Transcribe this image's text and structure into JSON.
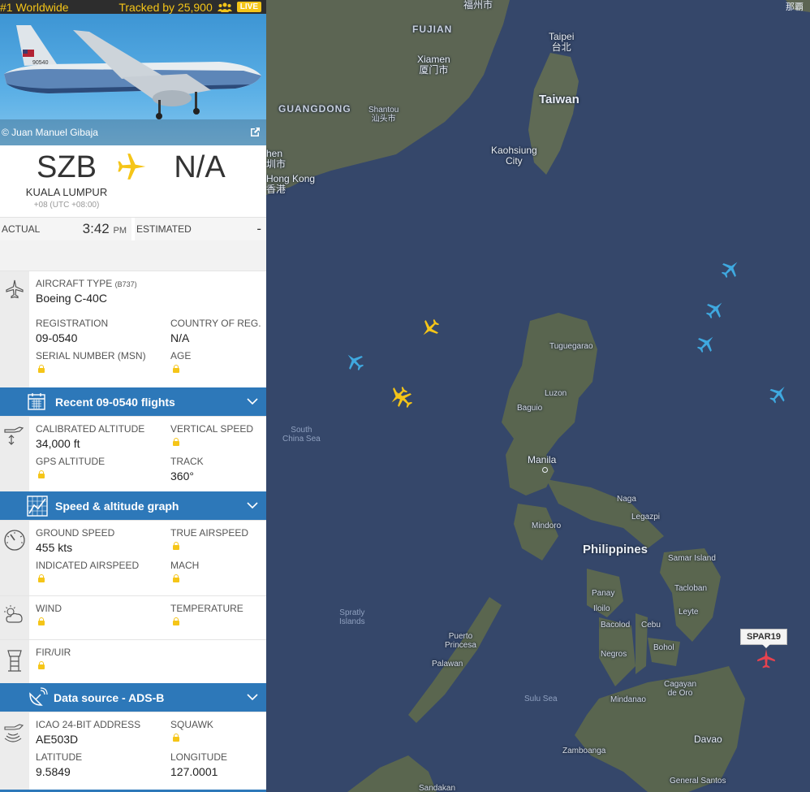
{
  "topbar": {
    "rank": "#1 Worldwide",
    "tracked": "Tracked by 25,900",
    "live": "LIVE"
  },
  "photo": {
    "credit": "© Juan Manuel Gibaja",
    "tail_text": "90540"
  },
  "route": {
    "origin_code": "SZB",
    "origin_city": "KUALA LUMPUR",
    "origin_tz": "+08 (UTC +08:00)",
    "dest_code": "N/A"
  },
  "times": {
    "actual_label": "ACTUAL",
    "actual_time": "3:42",
    "actual_ampm": "PM",
    "estimated_label": "ESTIMATED",
    "estimated_value": "-"
  },
  "aircraft": {
    "type_label": "AIRCRAFT TYPE",
    "type_code": "(B737)",
    "type_value": "Boeing C-40C",
    "registration_label": "REGISTRATION",
    "registration_value": "09-0540",
    "country_label": "COUNTRY OF REG.",
    "country_value": "N/A",
    "serial_label": "SERIAL NUMBER (MSN)",
    "age_label": "AGE"
  },
  "bars": {
    "recent_flights": "Recent 09-0540 flights",
    "speed_graph": "Speed & altitude graph",
    "data_source": "Data source - ADS-B"
  },
  "altitude": {
    "calibrated_label": "CALIBRATED ALTITUDE",
    "calibrated_value": "34,000 ft",
    "vertical_label": "VERTICAL SPEED",
    "gps_label": "GPS ALTITUDE",
    "track_label": "TRACK",
    "track_value": "360°"
  },
  "speed": {
    "ground_label": "GROUND SPEED",
    "ground_value": "455 kts",
    "true_label": "TRUE AIRSPEED",
    "indicated_label": "INDICATED AIRSPEED",
    "mach_label": "MACH"
  },
  "weather": {
    "wind_label": "WIND",
    "temp_label": "TEMPERATURE"
  },
  "fir": {
    "fir_label": "FIR/UIR"
  },
  "source": {
    "icao_label": "ICAO 24-BIT ADDRESS",
    "icao_value": "AE503D",
    "squawk_label": "SQUAWK",
    "lat_label": "LATITUDE",
    "lat_value": "9.5849",
    "lon_label": "LONGITUDE",
    "lon_value": "127.0001"
  },
  "map": {
    "callsign": "SPAR19",
    "labels": {
      "fuzhou": "福州市",
      "naha": "那覇",
      "fujian": "FUJIAN",
      "taipei": "Taipei",
      "taipei_cn": "台北",
      "xiamen": "Xiamen",
      "xiamen_cn": "厦门市",
      "taiwan": "Taiwan",
      "guangdong": "GUANGDONG",
      "shantou": "Shantou",
      "shantou_cn": "汕头市",
      "kaohsiung": "Kaohsiung",
      "city": "City",
      "shenzhen": "hen",
      "shenzhen_cn": "圳市",
      "hongkong": "Hong Kong",
      "hongkong_cn": "香港",
      "tuguegarao": "Tuguegarao",
      "luzon": "Luzon",
      "baguio": "Baguio",
      "south": "South",
      "chinasea": "China Sea",
      "manila": "Manila",
      "naga": "Naga",
      "legazpi": "Legazpi",
      "mindoro": "Mindoro",
      "philippines": "Philippines",
      "samar": "Samar Island",
      "tacloban": "Tacloban",
      "panay": "Panay",
      "leyte": "Leyte",
      "iloilo": "Iloilo",
      "bacolod": "Bacolod",
      "cebu": "Cebu",
      "spratly": "Spratly",
      "islands": "Islands",
      "puerto": "Puerto",
      "princesa": "Princesa",
      "bohol": "Bohol",
      "negros": "Negros",
      "palawan": "Palawan",
      "cagayan": "Cagayan",
      "deoro": "de Oro",
      "sulusea": "Sulu Sea",
      "mindanao": "Mindanao",
      "davao": "Davao",
      "zamboanga": "Zamboanga",
      "sandakan": "Sandakan",
      "gensantos": "General Santos"
    }
  },
  "colors": {
    "accent_blue": "#2d78b9",
    "live_yellow": "#f5c518",
    "plane_blue": "#3fa9e0",
    "plane_yellow": "#f5c518",
    "plane_red": "#e8424e"
  }
}
